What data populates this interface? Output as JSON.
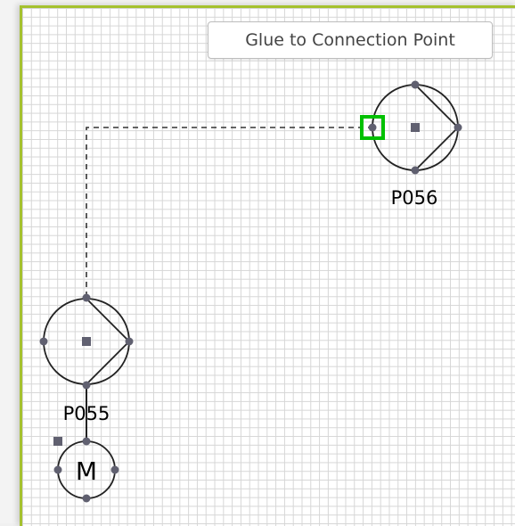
{
  "tooltip": {
    "text": "Glue to Connection Point"
  },
  "shapes": {
    "pump_top": {
      "label": "P056"
    },
    "pump_bottom": {
      "label": "P055"
    },
    "motor": {
      "label": "M"
    }
  },
  "colors": {
    "page_border": "#a5c12f",
    "grid_line": "#d6d6d6",
    "glue_highlight": "#00c000",
    "handle": "#606070",
    "shape_stroke": "#222222"
  }
}
